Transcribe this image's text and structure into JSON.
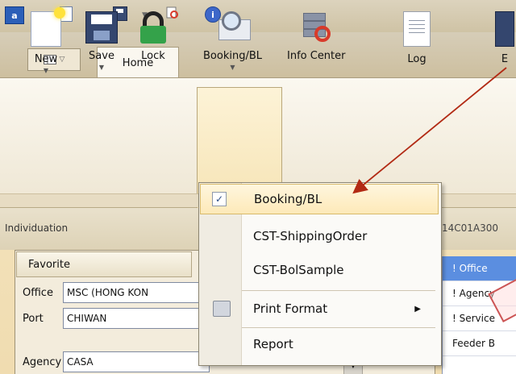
{
  "app": {
    "icon_label": "a"
  },
  "quick_access": {
    "info_glyph": "i"
  },
  "tabs": {
    "home_label": "Home"
  },
  "ribbon": {
    "buttons": [
      {
        "id": "new",
        "label": "New"
      },
      {
        "id": "save",
        "label": "Save"
      },
      {
        "id": "lock",
        "label": "Lock"
      },
      {
        "id": "booking",
        "label": "Booking/BL"
      },
      {
        "id": "info",
        "label": "Info Center"
      },
      {
        "id": "log",
        "label": "Log"
      },
      {
        "id": "edge",
        "label": "E"
      }
    ]
  },
  "individuation_bar": {
    "title": "Individuation",
    "code": "14C01A300"
  },
  "favorite": {
    "title": "Favorite",
    "fields": [
      {
        "label": "Office",
        "value": "MSC (HONG KON"
      },
      {
        "label": "Port",
        "value": "CHIWAN"
      },
      {
        "label": "Agency",
        "value": "CASA"
      }
    ]
  },
  "right_list": {
    "items": [
      {
        "label": "! Office",
        "selected": true
      },
      {
        "label": "! Agency",
        "selected": false
      },
      {
        "label": "! Service",
        "selected": false
      },
      {
        "label": "Feeder B",
        "selected": false
      }
    ]
  },
  "booking_menu": {
    "items": [
      {
        "label": "Booking/BL",
        "checked": true
      },
      {
        "label": "CST-ShippingOrder"
      },
      {
        "label": "CST-BolSample"
      },
      {
        "label": "Print Format",
        "has_submenu": true
      },
      {
        "label": "Report"
      }
    ],
    "check_glyph": "✓",
    "submenu_glyph": "▶"
  },
  "colors": {
    "annotation_arrow": "#b22a14",
    "selected_list": "#5b8ee0",
    "highlight": "#fde9b8"
  }
}
